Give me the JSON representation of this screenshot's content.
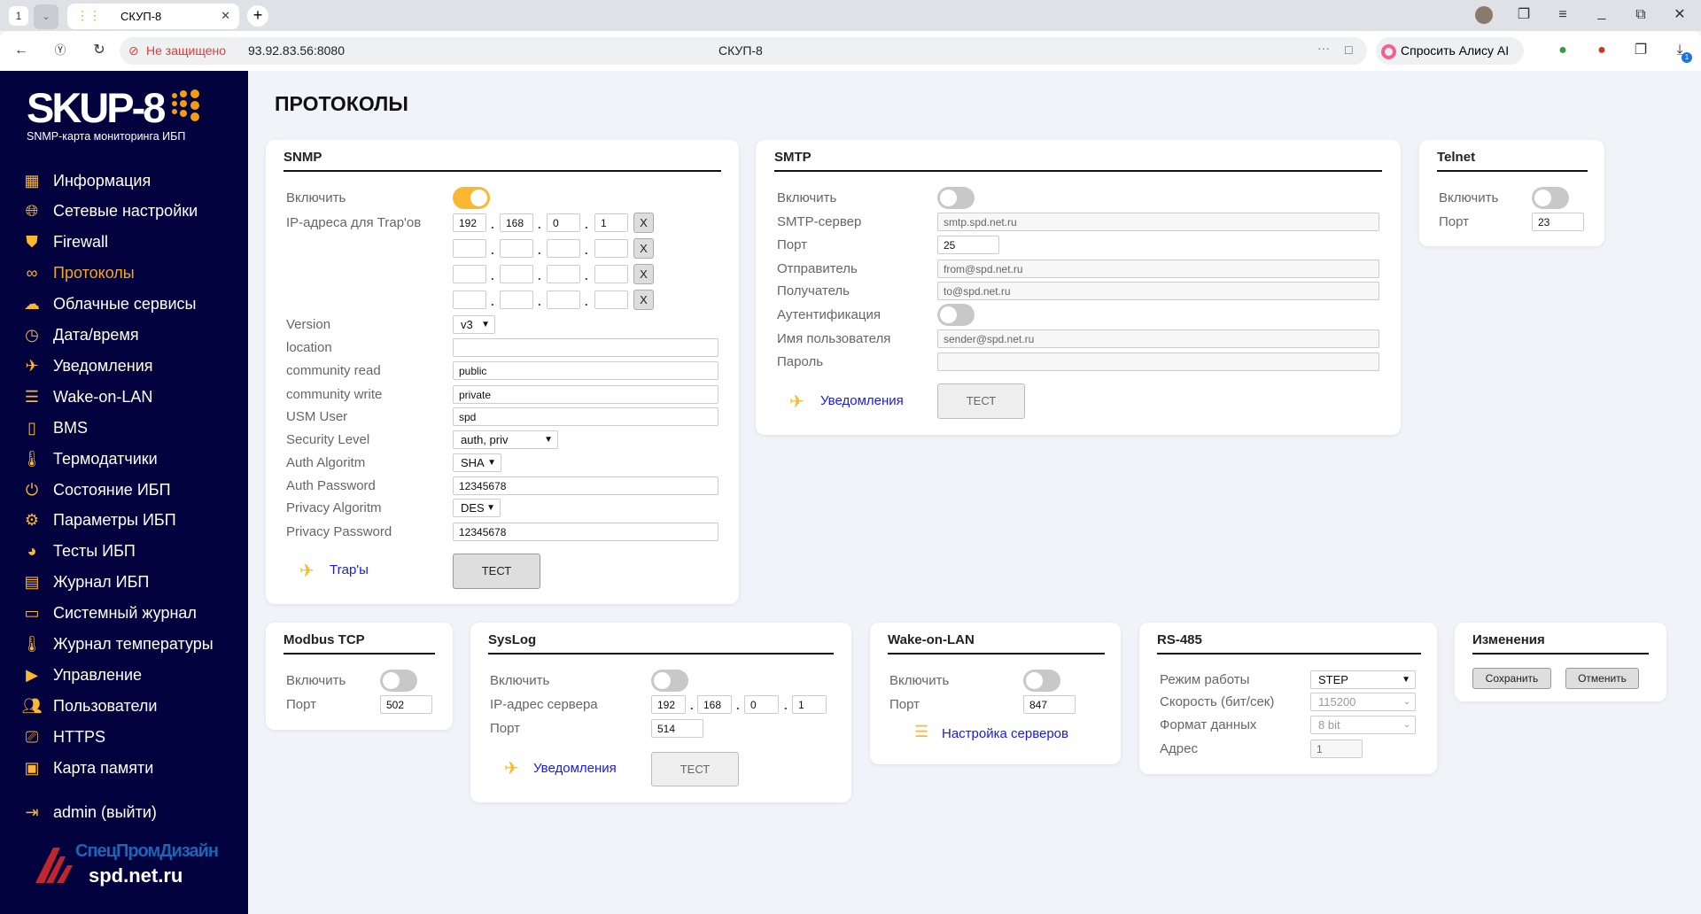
{
  "browser": {
    "tab_count": "1",
    "tab_title": "СКУП-8",
    "security_label": "Не защищено",
    "url": "93.92.83.56:8080",
    "page_title": "СКУП-8",
    "alice_label": "Спросить Алису AI",
    "downloads_badge": "1"
  },
  "sidebar": {
    "logo_text": "SKUP-8",
    "logo_subtitle": "SNMP-карта мониторинга ИБП",
    "items": [
      {
        "label": "Информация",
        "icon": "dashboard-icon"
      },
      {
        "label": "Сетевые настройки",
        "icon": "globe-icon"
      },
      {
        "label": "Firewall",
        "icon": "shield-icon"
      },
      {
        "label": "Протоколы",
        "icon": "protocols-icon",
        "active": true
      },
      {
        "label": "Облачные сервисы",
        "icon": "cloud-icon"
      },
      {
        "label": "Дата/время",
        "icon": "clock-icon"
      },
      {
        "label": "Уведомления",
        "icon": "paper-plane-icon"
      },
      {
        "label": "Wake-on-LAN",
        "icon": "server-icon"
      },
      {
        "label": "BMS",
        "icon": "battery-icon"
      },
      {
        "label": "Термодатчики",
        "icon": "thermometer-icon"
      },
      {
        "label": "Состояние ИБП",
        "icon": "power-icon"
      },
      {
        "label": "Параметры ИБП",
        "icon": "gear-icon"
      },
      {
        "label": "Тесты ИБП",
        "icon": "chart-icon"
      },
      {
        "label": "Журнал ИБП",
        "icon": "document-icon"
      },
      {
        "label": "Системный журнал",
        "icon": "monitor-icon"
      },
      {
        "label": "Журнал температуры",
        "icon": "thermometer-icon"
      },
      {
        "label": "Управление",
        "icon": "play-icon"
      },
      {
        "label": "Пользователи",
        "icon": "users-icon"
      },
      {
        "label": "HTTPS",
        "icon": "ssl-icon"
      },
      {
        "label": "Карта памяти",
        "icon": "sd-card-icon"
      }
    ],
    "logout_label": "admin (выйти)",
    "footer_brand": "СпецПромДизайн",
    "footer_site": "spd.net.ru"
  },
  "page": {
    "title": "ПРОТОКОЛЫ"
  },
  "snmp": {
    "title": "SNMP",
    "enable_label": "Включить",
    "enabled": true,
    "trap_ips_label": "IP-адреса для Trap'ов",
    "trap_ips": [
      [
        "192",
        "168",
        "0",
        "1"
      ],
      [
        "",
        "",
        "",
        ""
      ],
      [
        "",
        "",
        "",
        ""
      ],
      [
        "",
        "",
        "",
        ""
      ]
    ],
    "remove_label": "X",
    "version_label": "Version",
    "version": "v3",
    "location_label": "location",
    "location": "",
    "community_read_label": "community read",
    "community_read": "public",
    "community_write_label": "community write",
    "community_write": "private",
    "usm_user_label": "USM User",
    "usm_user": "spd",
    "security_level_label": "Security Level",
    "security_level": "auth, priv",
    "auth_alg_label": "Auth Algoritm",
    "auth_alg": "SHA",
    "auth_pw_label": "Auth Password",
    "auth_pw": "12345678",
    "priv_alg_label": "Privacy Algoritm",
    "priv_alg": "DES",
    "priv_pw_label": "Privacy Password",
    "priv_pw": "12345678",
    "traps_link": "Trap'ы",
    "test_label": "ТЕСТ"
  },
  "smtp": {
    "title": "SMTP",
    "enable_label": "Включить",
    "enabled": false,
    "server_label": "SMTP-сервер",
    "server": "smtp.spd.net.ru",
    "port_label": "Порт",
    "port": "25",
    "sender_label": "Отправитель",
    "sender": "from@spd.net.ru",
    "recipient_label": "Получатель",
    "recipient": "to@spd.net.ru",
    "auth_label": "Аутентификация",
    "auth": false,
    "username_label": "Имя пользователя",
    "username": "sender@spd.net.ru",
    "password_label": "Пароль",
    "password": "",
    "notifications_link": "Уведомления",
    "test_label": "ТЕСТ"
  },
  "telnet": {
    "title": "Telnet",
    "enable_label": "Включить",
    "enabled": false,
    "port_label": "Порт",
    "port": "23"
  },
  "modbus": {
    "title": "Modbus TCP",
    "enable_label": "Включить",
    "enabled": false,
    "port_label": "Порт",
    "port": "502"
  },
  "syslog": {
    "title": "SysLog",
    "enable_label": "Включить",
    "enabled": false,
    "ip_label": "IP-адрес сервера",
    "ip": [
      "192",
      "168",
      "0",
      "1"
    ],
    "port_label": "Порт",
    "port": "514",
    "notifications_link": "Уведомления",
    "test_label": "ТЕСТ"
  },
  "wol": {
    "title": "Wake-on-LAN",
    "enable_label": "Включить",
    "enabled": false,
    "port_label": "Порт",
    "port": "847",
    "servers_link": "Настройка серверов"
  },
  "rs485": {
    "title": "RS-485",
    "mode_label": "Режим работы",
    "mode": "STEP",
    "speed_label": "Скорость (бит/сек)",
    "speed": "115200",
    "format_label": "Формат данных",
    "format": "8 bit",
    "address_label": "Адрес",
    "address": "1"
  },
  "changes": {
    "title": "Изменения",
    "save_label": "Сохранить",
    "cancel_label": "Отменить"
  },
  "colors": {
    "sidebar_bg": "#02023f",
    "accent": "#fbb731",
    "active_item": "#f5a623",
    "link": "#1a1ae6",
    "page_bg": "#f2f3f8"
  }
}
